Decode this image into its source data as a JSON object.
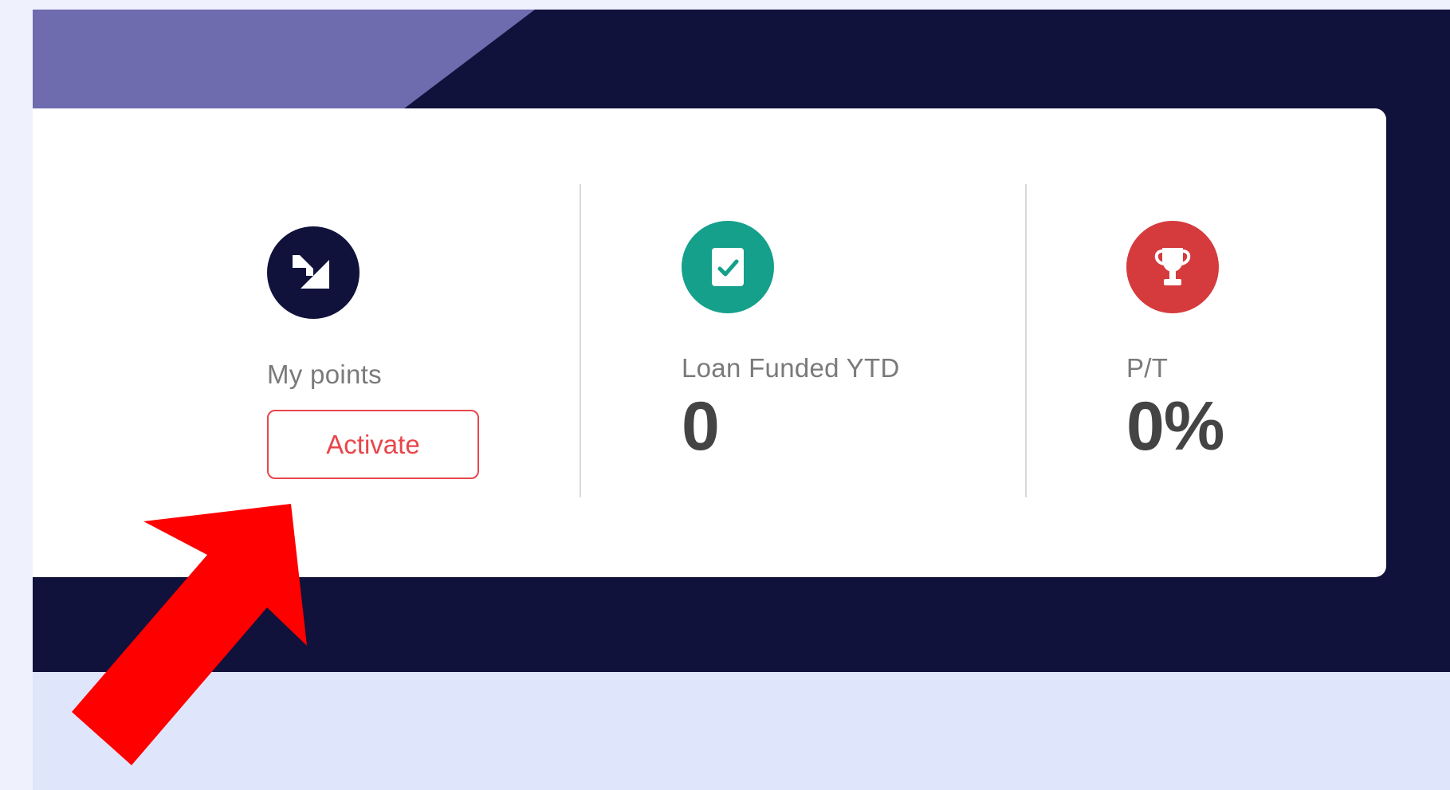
{
  "colors": {
    "banner": "#10123b",
    "banner_accent": "#6e6bae",
    "card": "#ffffff",
    "content_band": "#dfe5fb",
    "points_icon_bg": "#10123b",
    "loans_icon_bg": "#14a08a",
    "pt_icon_bg": "#d53a3d",
    "activate_accent": "#e8464b",
    "annotation_arrow": "#ff0000"
  },
  "stats": {
    "points": {
      "icon": "points-logo-icon",
      "label": "My points",
      "button_label": "Activate"
    },
    "loans": {
      "icon": "clipboard-check-icon",
      "label": "Loan Funded YTD",
      "value": "0"
    },
    "pt": {
      "icon": "trophy-icon",
      "label": "P/T",
      "value": "0%"
    }
  },
  "annotation": {
    "icon": "red-arrow-icon"
  }
}
